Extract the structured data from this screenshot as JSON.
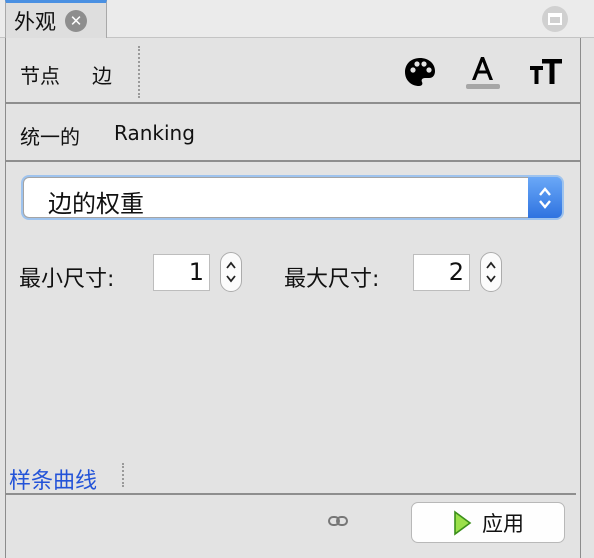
{
  "window": {
    "tab_title": "外观",
    "tab_close_icon": "close-icon",
    "restore_icon": "restore-icon"
  },
  "toolbar": {
    "items": [
      {
        "label": "节点"
      },
      {
        "label": "边"
      }
    ],
    "icons": [
      "palette-icon",
      "text-color-icon",
      "text-size-icon"
    ],
    "text_color_underline": "#a6a6a6"
  },
  "subtabs": {
    "items": [
      {
        "label": "统一的"
      },
      {
        "label": "Ranking"
      }
    ]
  },
  "ranking": {
    "attribute_select": {
      "value": "边的权重"
    },
    "min_size": {
      "label": "最小尺寸:",
      "value": "1"
    },
    "max_size": {
      "label": "最大尺寸:",
      "value": "2"
    }
  },
  "footer": {
    "spline_link": "样条曲线",
    "link_icon": "chain-link-icon",
    "apply_label": "应用",
    "apply_icon": "play-icon"
  },
  "colors": {
    "tab_accent": "#4a90e2",
    "select_accent": "#2f73e0",
    "link_text": "#2353d8",
    "apply_icon_fill": "#9be04a"
  }
}
